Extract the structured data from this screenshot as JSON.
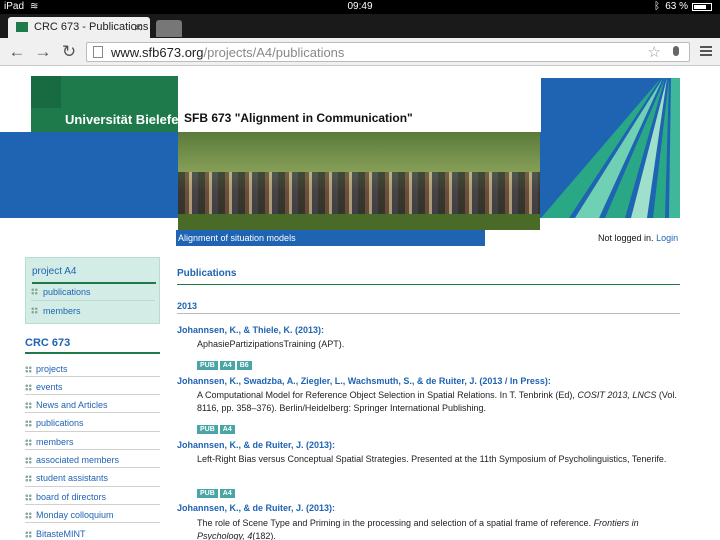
{
  "status_bar": {
    "device": "iPad",
    "time": "09:49",
    "battery": "63 %"
  },
  "browser": {
    "tab_title": "CRC 673 - Publications",
    "url_host": "www.sfb673.org",
    "url_path": "/projects/A4/publications"
  },
  "header": {
    "university": "Universität Bielefeld",
    "sfb_title": "SFB 673 \"Alignment in Communication\"",
    "project_code": "A4",
    "project_subtitle": "Alignment of situation models",
    "login_status": "Not logged in.",
    "login_link": "Login"
  },
  "sidebar": {
    "project_title": "project A4",
    "project_links": [
      "publications",
      "members"
    ],
    "crc_title": "CRC 673",
    "crc_links": [
      "projects",
      "events",
      "News and Articles",
      "publications",
      "members",
      "associated members",
      "student assistants",
      "board of directors",
      "Monday colloquium",
      "BitasteMINT"
    ]
  },
  "main": {
    "heading": "Publications",
    "year": "2013",
    "publications": [
      {
        "authors": "Johannsen, K., & Thiele, K. (2013):",
        "text": "AphasiePartizipationsTraining (APT).",
        "tags": [
          "PUB",
          "A4",
          "B6"
        ]
      },
      {
        "authors": "Johannsen, K., Swadzba, A., Ziegler, L., Wachsmuth, S., & de Ruiter, J. (2013 / In Press):",
        "text_parts": [
          "A Computational Model for Reference Object Selection in Spatial Relations. In T. Tenbrink (Ed), ",
          "COSIT 2013, LNCS",
          " (Vol. 8116, pp. 358–376). Berlin/Heidelberg: Springer International Publishing."
        ],
        "tags": [
          "PUB",
          "A4"
        ]
      },
      {
        "authors": "Johannsen, K., & de Ruiter, J. (2013):",
        "text": "Left-Right Bias versus Conceptual Spatial Strategies. Presented at the 11th Symposium of Psycholinguistics, Tenerife.",
        "tags": [
          "PUB",
          "A4"
        ]
      },
      {
        "authors": "Johannsen, K., & de Ruiter, J. (2013):",
        "text_parts": [
          "The role of Scene Type and Priming in the processing and selection of a spatial frame of reference. ",
          "Frontiers in Psychology, 4",
          "(182)."
        ]
      }
    ]
  },
  "colors": {
    "green": "#1e7a4a",
    "blue": "#1f63b3",
    "sidebar_bg": "#d3ede6",
    "tag": "#4aa6a6"
  },
  "icons": [
    "wifi-icon",
    "bluetooth-icon",
    "battery-icon",
    "back-icon",
    "forward-icon",
    "reload-icon",
    "page-icon",
    "star-icon",
    "mic-icon",
    "menu-icon"
  ]
}
